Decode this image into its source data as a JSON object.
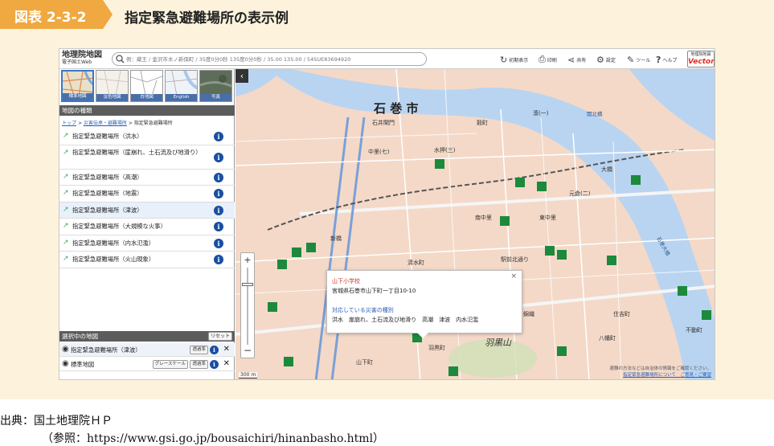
{
  "figure": {
    "number": "図表 2-3-2",
    "title": "指定緊急避難場所の表示例",
    "source": "出典：国土地理院ＨＰ",
    "reference": "（参照：https://www.gsi.go.jp/bousaichiri/hinanbasho.html）"
  },
  "app": {
    "logo_line1": "地理院地図",
    "logo_line2": "電子国土Web",
    "search_placeholder": "例：蔵王 / 金沢市木ノ新保町 / 35度0分0秒 135度0分0秒 / 35.00 135.00 / 54SUE83694920",
    "tools": [
      {
        "icon": "refresh-icon",
        "glyph": "↻",
        "label": "初期表示"
      },
      {
        "icon": "print-icon",
        "glyph": "⎙",
        "label": "印刷"
      },
      {
        "icon": "share-icon",
        "glyph": "⋖",
        "label": "共有"
      },
      {
        "icon": "gear-icon",
        "glyph": "⚙",
        "label": "設定"
      },
      {
        "icon": "tool-icon",
        "glyph": "✎",
        "label": "ツール"
      },
      {
        "icon": "help-icon",
        "glyph": "?",
        "label": "ヘルプ"
      }
    ],
    "vector_line1": "地理院地図",
    "vector_line2": "Vector"
  },
  "sidebar": {
    "thumbnails": [
      {
        "label": "標準地図",
        "selected": true
      },
      {
        "label": "淡色地図",
        "selected": false
      },
      {
        "label": "白地図",
        "selected": false
      },
      {
        "label": "English",
        "selected": false
      },
      {
        "label": "写真",
        "selected": false
      }
    ],
    "map_types_header": "地図の種類",
    "breadcrumb": {
      "top": "トップ",
      "sep1": ">",
      "mid": "災害伝承・避難場所",
      "sep2": ">",
      "current": "指定緊急避難場所"
    },
    "layers": [
      {
        "label": "指定緊急避難場所（洪水）",
        "highlighted": false
      },
      {
        "label": "指定緊急避難場所（崖崩れ、土石流及び地滑り）",
        "highlighted": false
      },
      {
        "label": "指定緊急避難場所（高潮）",
        "highlighted": false
      },
      {
        "label": "指定緊急避難場所（地震）",
        "highlighted": false
      },
      {
        "label": "指定緊急避難場所（津波）",
        "highlighted": true
      },
      {
        "label": "指定緊急避難場所（大規模な火事）",
        "highlighted": false
      },
      {
        "label": "指定緊急避難場所（内水氾濫）",
        "highlighted": false
      },
      {
        "label": "指定緊急避難場所（火山現象）",
        "highlighted": false
      }
    ],
    "selected_header": "選択中の地図",
    "reset_label": "リセット",
    "selected_maps": [
      {
        "label": "指定緊急避難場所（津波）",
        "buttons": [
          "透過率"
        ]
      },
      {
        "label": "標準地図",
        "buttons": [
          "グレースケール",
          "透過率"
        ]
      }
    ]
  },
  "map": {
    "labels": [
      {
        "text": "石 巻 市",
        "big": true
      },
      {
        "text": "石井閘門"
      },
      {
        "text": "新橋"
      },
      {
        "text": "湊(一)"
      },
      {
        "text": "開北橋"
      },
      {
        "text": "羽黒山"
      },
      {
        "text": "山下町"
      },
      {
        "text": "羽黒町"
      },
      {
        "text": "東中里"
      },
      {
        "text": "南中里"
      },
      {
        "text": "中里(七)"
      },
      {
        "text": "水押(三)"
      },
      {
        "text": "穀町"
      },
      {
        "text": "元倉(二)"
      },
      {
        "text": "大橋"
      },
      {
        "text": "八幡町"
      },
      {
        "text": "石巻大橋"
      },
      {
        "text": "住吉町"
      },
      {
        "text": "不動町"
      },
      {
        "text": "錦織"
      },
      {
        "text": "清水町"
      },
      {
        "text": "駅前北通り"
      }
    ],
    "scale_label": "300 m",
    "popup": {
      "title": "山下小学校",
      "address": "宮城県石巻市山下町一丁目10-10",
      "hazard_header": "対応している災害の種別",
      "hazards": "洪水　崖崩れ、土石流及び地滑り　高潮　津波　内水氾濫"
    },
    "attribution_line1": "避難の方法などは自治体の情報をご確認ください。",
    "attribution_line2": "指定緊急避難場所について　ご意見・ご要望"
  },
  "colors": {
    "accent": "#f0a840",
    "panel": "#fdf3dc",
    "map_base": "#f4d9c8",
    "water": "#b9d4f1",
    "shelter": "#1c8a3c"
  }
}
